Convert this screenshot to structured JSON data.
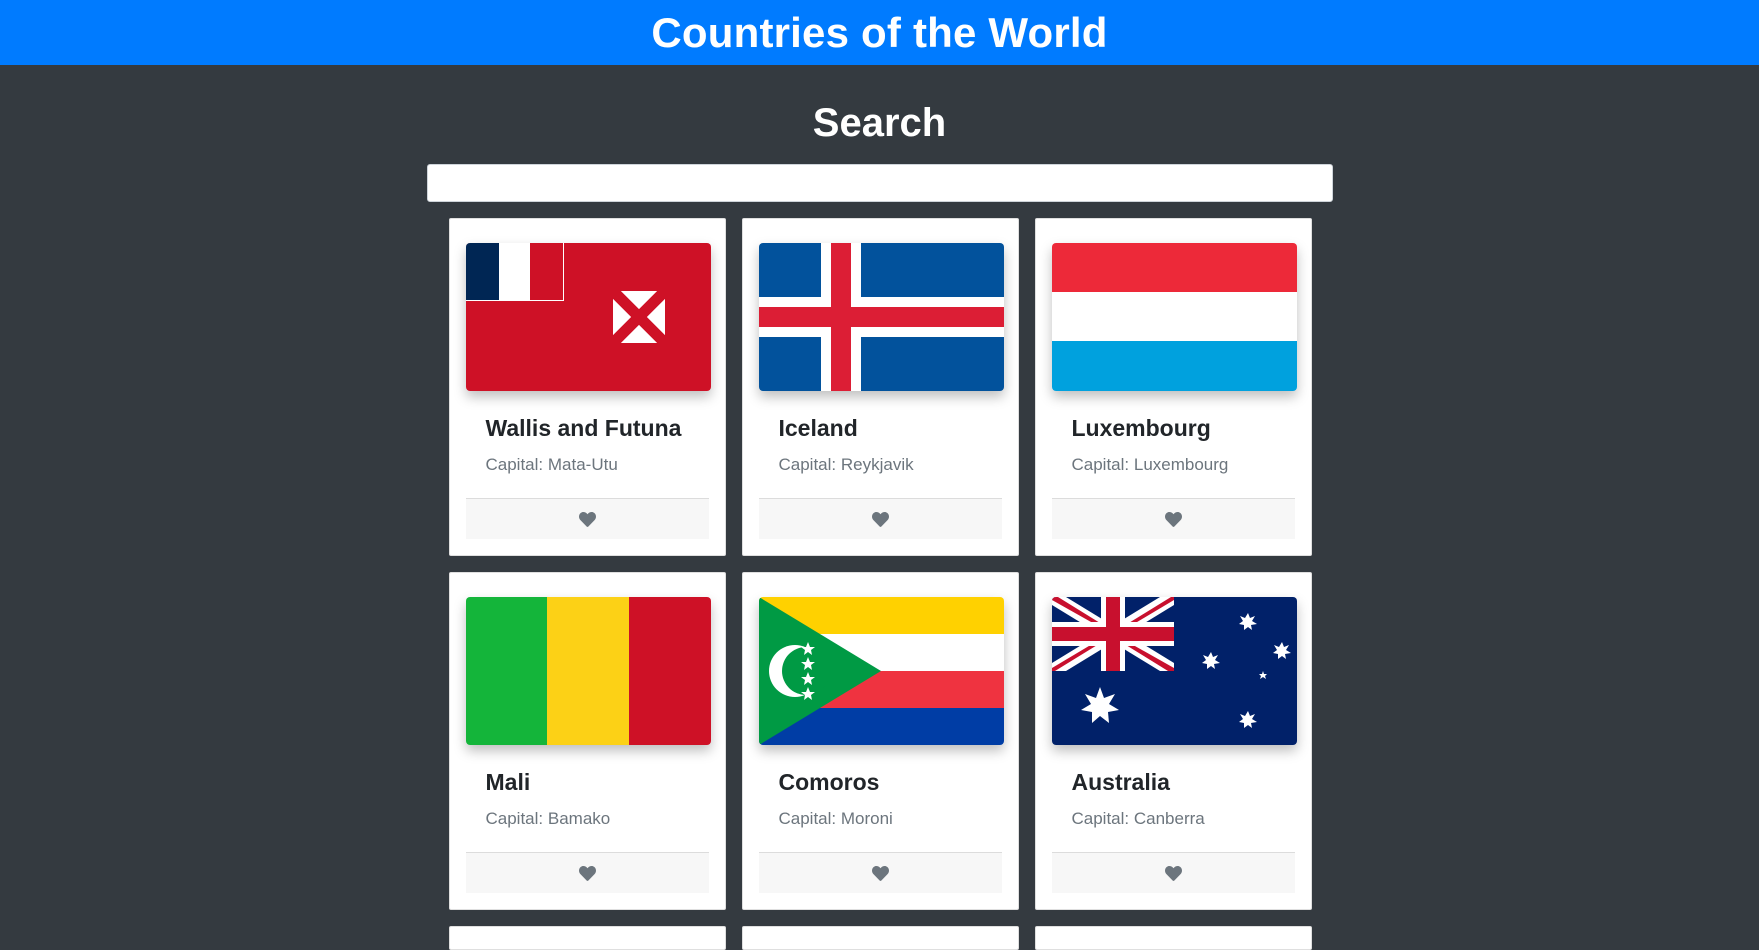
{
  "navbar": {
    "title": "Countries of the World",
    "color": "#007bff"
  },
  "search": {
    "title": "Search",
    "value": "",
    "placeholder": ""
  },
  "capital_prefix": "Capital: ",
  "countries": [
    {
      "name": "Wallis and Futuna",
      "capital": "Mata-Utu",
      "flag": "wallis-futuna"
    },
    {
      "name": "Iceland",
      "capital": "Reykjavik",
      "flag": "iceland"
    },
    {
      "name": "Luxembourg",
      "capital": "Luxembourg",
      "flag": "luxembourg"
    },
    {
      "name": "Mali",
      "capital": "Bamako",
      "flag": "mali"
    },
    {
      "name": "Comoros",
      "capital": "Moroni",
      "flag": "comoros"
    },
    {
      "name": "Australia",
      "capital": "Canberra",
      "flag": "australia"
    }
  ],
  "favorite_icon": "heart-icon",
  "colors": {
    "page_bg": "#343a40",
    "card_bg": "#ffffff",
    "heart": "#6c757d"
  }
}
